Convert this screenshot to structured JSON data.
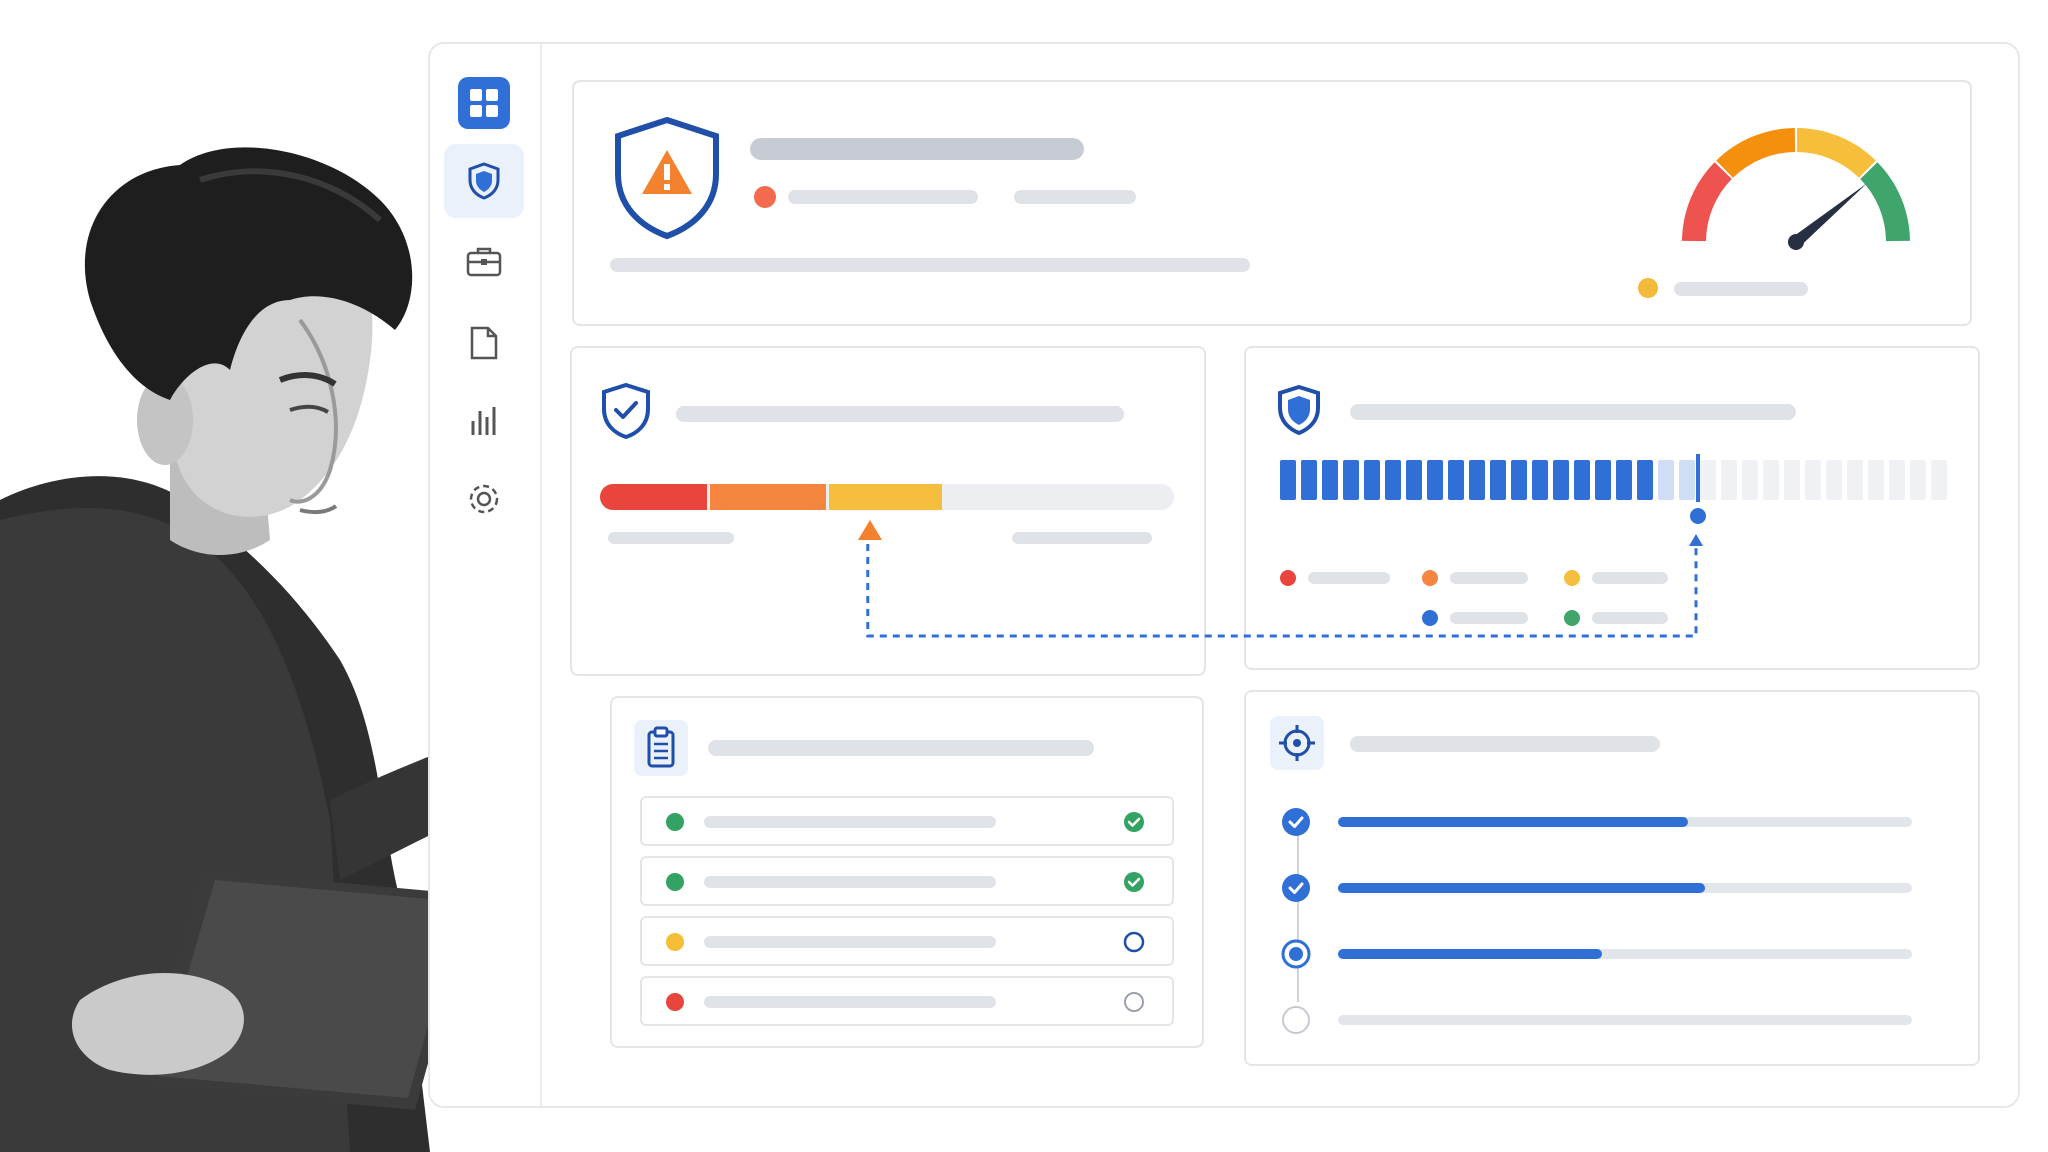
{
  "sidebar": {
    "items": [
      {
        "icon": "apps-grid-icon"
      },
      {
        "icon": "shield-icon",
        "active": true
      },
      {
        "icon": "briefcase-icon"
      },
      {
        "icon": "document-icon"
      },
      {
        "icon": "bar-chart-icon"
      },
      {
        "icon": "gear-icon"
      }
    ]
  },
  "alert_card": {
    "icon": "shield-warning-icon",
    "status_color": "#f26b4f"
  },
  "gauge": {
    "level": 0.78,
    "segments": [
      "#ef5350",
      "#f5900f",
      "#f7be3c",
      "#3fa56a"
    ],
    "indicator_color": "#f3b93b"
  },
  "risk_card": {
    "icon": "shield-check-icon",
    "level": 0.47,
    "segments": [
      "#e8453c",
      "#f58640",
      "#f6be3f",
      "#eceef1"
    ]
  },
  "coverage_card": {
    "icon": "shield-icon",
    "filled_fraction": 0.64,
    "legend_colors": [
      "#e8453c",
      "#f58640",
      "#f6be3f",
      "#2f6fd6",
      "#3fa56a"
    ]
  },
  "checklist_card": {
    "icon": "clipboard-icon",
    "rows": [
      {
        "color": "#33a363",
        "status": "done"
      },
      {
        "color": "#33a363",
        "status": "done"
      },
      {
        "color": "#f6bd36",
        "status": "pending"
      },
      {
        "color": "#e8453c",
        "status": "empty"
      }
    ]
  },
  "targets_card": {
    "icon": "target-icon",
    "steps": [
      {
        "status": "done",
        "progress": 0.61
      },
      {
        "status": "done",
        "progress": 0.64
      },
      {
        "status": "active",
        "progress": 0.46
      },
      {
        "status": "empty",
        "progress": 0
      }
    ]
  },
  "colors": {
    "accent": "#2f6fd6",
    "warning": "#f4812d"
  }
}
